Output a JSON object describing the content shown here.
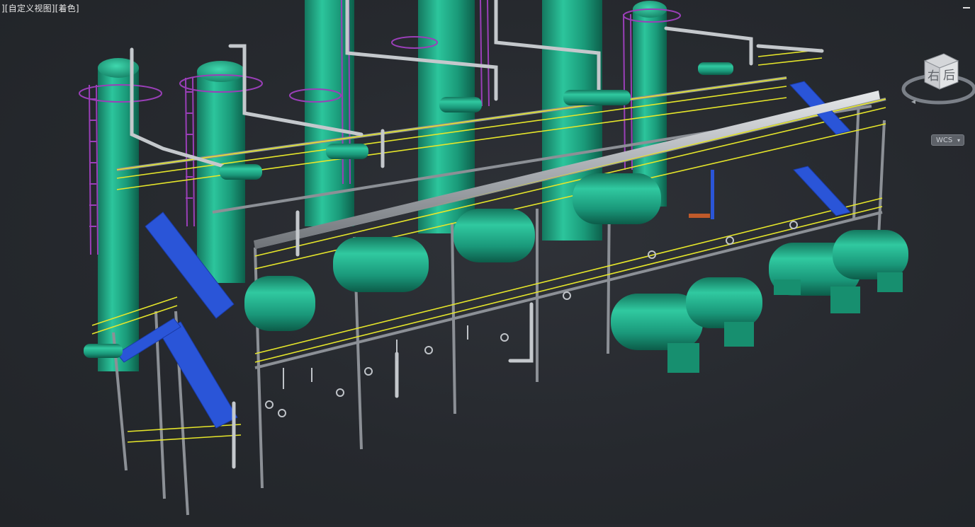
{
  "viewport": {
    "label": "][自定义视图][着色]",
    "minimize_icon": "minimize-icon"
  },
  "viewcube": {
    "face_right": "右",
    "face_back": "后",
    "compass_icon": "compass-ring-icon"
  },
  "ucs": {
    "label": "WCS",
    "caret": "▾"
  },
  "colors": {
    "background": "#2b2e33",
    "equipment": "#1f9f80",
    "railing": "#e6e62a",
    "stair": "#2a55d8",
    "ladder": "#9a3fb8",
    "pipe": "#c4c8cc",
    "steel": "#8c9096"
  }
}
